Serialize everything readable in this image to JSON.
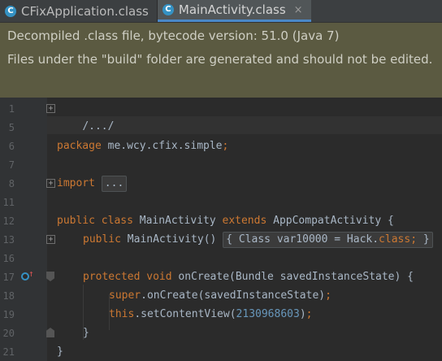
{
  "tabs": [
    {
      "label": "CFixApplication.class",
      "icon": "class-icon",
      "active": false
    },
    {
      "label": "MainActivity.class",
      "icon": "class-icon",
      "active": true,
      "close": "×"
    }
  ],
  "banner": {
    "line1": "Decompiled .class file, bytecode version: 51.0 (Java 7)",
    "line2": "Files under the \"build\" folder are generated and should not be edited."
  },
  "line_numbers": [
    "1",
    "5",
    "6",
    "7",
    "8",
    "11",
    "12",
    "13",
    "16",
    "17",
    "18",
    "19",
    "20",
    "21"
  ],
  "code": {
    "l1": "/.../",
    "l6_kw": "package",
    "l6_rest": " me.wcy.cfix.simple",
    "l6_semi": ";",
    "l8_kw": "import",
    "l8_fold": "...",
    "l12_kw1": "public class",
    "l12_name": " MainActivity ",
    "l12_kw2": "extends",
    "l12_rest": " AppCompatActivity {",
    "l13_kw": "public",
    "l13_rest": " MainActivity() ",
    "l13_fold_a": "{ Class var10000 = Hack.",
    "l13_fold_kw": "class",
    "l13_fold_semi": ";",
    "l13_fold_b": " }",
    "l17_kw": "protected void",
    "l17_rest": " onCreate(Bundle savedInstanceState) {",
    "l18_kw": "super",
    "l18_rest": ".onCreate(savedInstanceState)",
    "l18_semi": ";",
    "l19_kw": "this",
    "l19_rest": ".setContentView(",
    "l19_num": "2130968603",
    "l19_close": ")",
    "l19_semi": ";",
    "l20": "}",
    "l21": "}"
  },
  "colors": {
    "keyword": "#cc7832",
    "number": "#6897bb",
    "text": "#a9b7c6",
    "banner_bg": "#5b5a41",
    "active_tab_underline": "#4a88c7"
  }
}
